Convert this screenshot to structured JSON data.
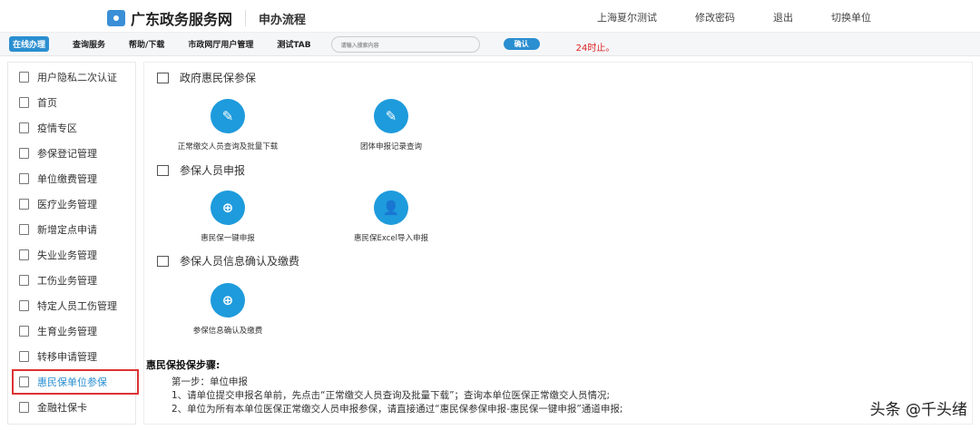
{
  "header": {
    "site_title": "广东政务服务网",
    "subtitle": "申办流程",
    "links": [
      "上海夏尔测试",
      "修改密码",
      "退出",
      "切换单位"
    ]
  },
  "nav": {
    "tabs": [
      "在线办理",
      "查询服务",
      "帮助/下载",
      "市政网厅用户管理",
      "测试TAB"
    ],
    "search_placeholder": "请输入搜索内容",
    "confirm": "确认",
    "notice": "24时止。"
  },
  "sidebar": {
    "items": [
      "用户隐私二次认证",
      "首页",
      "疫情专区",
      "参保登记管理",
      "单位缴费管理",
      "医疗业务管理",
      "新增定点申请",
      "失业业务管理",
      "工伤业务管理",
      "特定人员工伤管理",
      "生育业务管理",
      "转移申请管理",
      "惠民保单位参保",
      "金融社保卡"
    ],
    "selected": "惠民保单位参保"
  },
  "sections": [
    {
      "title": "政府惠民保参保",
      "items": [
        "正常缴交人员查询及批量下载",
        "团体申报记录查询"
      ]
    },
    {
      "title": "参保人员申报",
      "items": [
        "惠民保一键申报",
        "惠民保Excel导入申报"
      ]
    },
    {
      "title": "参保人员信息确认及缴费",
      "items": [
        "参保信息确认及缴费"
      ]
    }
  ],
  "steps": {
    "title": "惠民保投保步骤:",
    "lines": [
      "第一步：单位申报",
      "1、请单位提交申报名单前，先点击“正常缴交人员查询及批量下载”；查询本单位医保正常缴交人员情况;",
      "2、单位为所有本单位医保正常缴交人员申报参保，请直接通过“惠民保参保申报-惠民保一键申报”通道申报;"
    ]
  },
  "watermark": "头条 @千头绪",
  "colors": {
    "accent": "#1e9bdc",
    "highlight": "#dd3333"
  }
}
